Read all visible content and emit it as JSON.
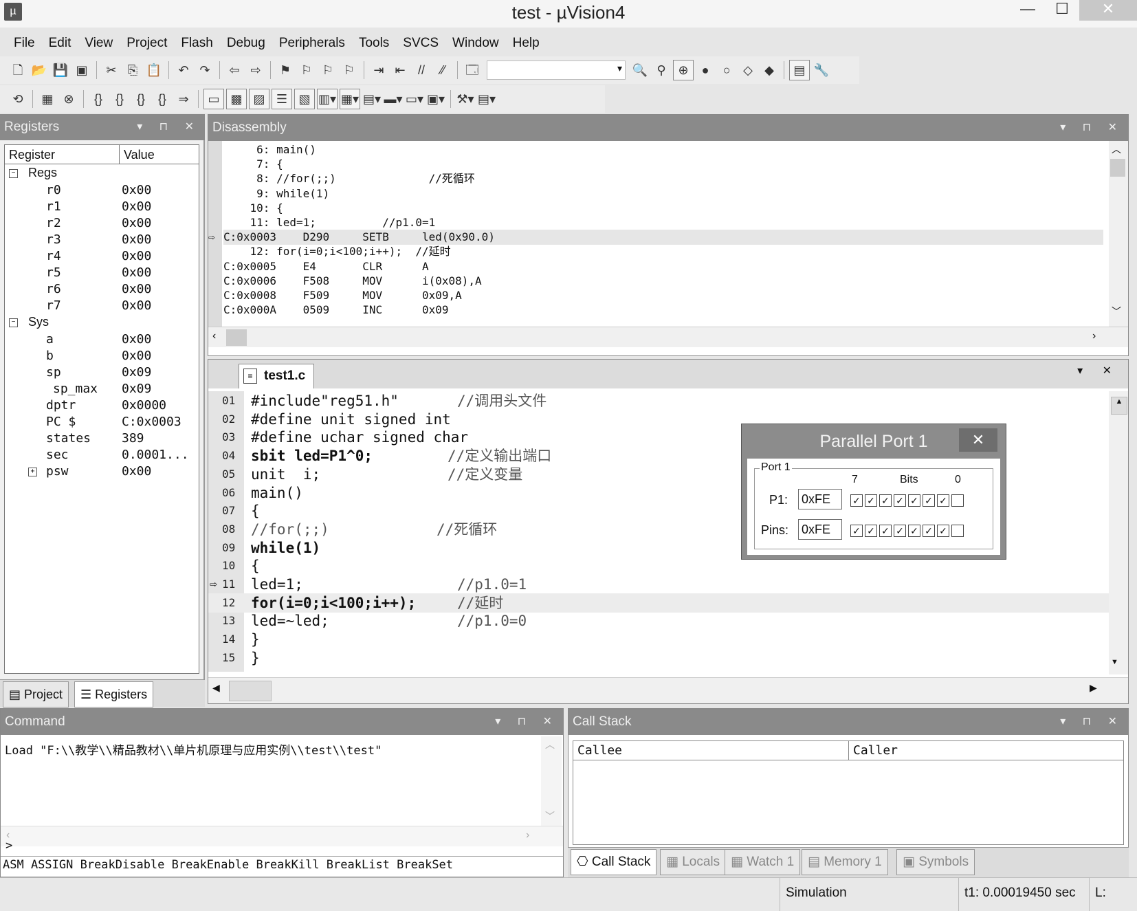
{
  "window": {
    "title": "test  - µVision4",
    "app_icon": "µ",
    "buttons": {
      "minimize": "—",
      "maximize": "☐",
      "close": "✕"
    }
  },
  "menu": [
    "File",
    "Edit",
    "View",
    "Project",
    "Flash",
    "Debug",
    "Peripherals",
    "Tools",
    "SVCS",
    "Window",
    "Help"
  ],
  "registers": {
    "title": "Registers",
    "columns": [
      "Register",
      "Value"
    ],
    "groups": [
      {
        "name": "Regs",
        "expanded": true,
        "items": [
          {
            "name": "r0",
            "value": "0x00"
          },
          {
            "name": "r1",
            "value": "0x00"
          },
          {
            "name": "r2",
            "value": "0x00"
          },
          {
            "name": "r3",
            "value": "0x00"
          },
          {
            "name": "r4",
            "value": "0x00"
          },
          {
            "name": "r5",
            "value": "0x00"
          },
          {
            "name": "r6",
            "value": "0x00"
          },
          {
            "name": "r7",
            "value": "0x00"
          }
        ]
      },
      {
        "name": "Sys",
        "expanded": true,
        "items": [
          {
            "name": "a",
            "value": "0x00"
          },
          {
            "name": "b",
            "value": "0x00"
          },
          {
            "name": "sp",
            "value": "0x09"
          },
          {
            "name": "sp_max",
            "value": "0x09"
          },
          {
            "name": "dptr",
            "value": "0x0000"
          },
          {
            "name": "PC  $",
            "value": "C:0x0003"
          },
          {
            "name": "states",
            "value": "389"
          },
          {
            "name": "sec",
            "value": "0.0001..."
          },
          {
            "name": "psw",
            "value": "0x00"
          }
        ]
      }
    ],
    "tabs": [
      "Project",
      "Registers"
    ]
  },
  "disassembly": {
    "title": "Disassembly",
    "lines": [
      {
        "text": "     6: main()",
        "current": false
      },
      {
        "text": "     7: {",
        "current": false
      },
      {
        "text": "     8: //for(;;)              //死循环",
        "current": false
      },
      {
        "text": "     9: while(1)",
        "current": false
      },
      {
        "text": "    10: {",
        "current": false
      },
      {
        "text": "    11: led=1;          //p1.0=1",
        "current": false
      },
      {
        "text": "C:0x0003    D290     SETB     led(0x90.0)",
        "current": true
      },
      {
        "text": "    12: for(i=0;i<100;i++);  //延时",
        "current": false
      },
      {
        "text": "C:0x0005    E4       CLR      A",
        "current": false
      },
      {
        "text": "C:0x0006    F508     MOV      i(0x08),A",
        "current": false
      },
      {
        "text": "C:0x0008    F509     MOV      0x09,A",
        "current": false
      },
      {
        "text": "C:0x000A    0509     INC      0x09",
        "current": false
      }
    ]
  },
  "editor": {
    "tab": "test1.c",
    "lines": [
      {
        "num": "01",
        "code": "#include\"reg51.h\"",
        "comment": "//调用头文件",
        "bold": false
      },
      {
        "num": "02",
        "code": "#define unit signed int",
        "comment": "",
        "bold": false
      },
      {
        "num": "03",
        "code": "#define uchar signed char",
        "comment": "",
        "bold": false
      },
      {
        "num": "04",
        "code": "sbit led=P1^0;",
        "comment": "//定义输出端口",
        "bold": false
      },
      {
        "num": "05",
        "code": "unit  i;",
        "comment": "//定义变量",
        "bold": false
      },
      {
        "num": "06",
        "code": "main()",
        "comment": "",
        "bold": false
      },
      {
        "num": "07",
        "code": "{",
        "comment": "",
        "bold": false
      },
      {
        "num": "08",
        "code": "//for(;;)",
        "comment": "//死循环",
        "bold": false
      },
      {
        "num": "09",
        "code": "while(1)",
        "comment": "",
        "bold": false
      },
      {
        "num": "10",
        "code": "{",
        "comment": "",
        "bold": false
      },
      {
        "num": "11",
        "code": "led=1;",
        "comment": "//p1.0=1",
        "bold": false
      },
      {
        "num": "12",
        "code": "for(i=0;i<100;i++);",
        "comment": "//延时",
        "bold": false
      },
      {
        "num": "13",
        "code": "led=~led;",
        "comment": "//p1.0=0",
        "bold": false
      },
      {
        "num": "14",
        "code": "}",
        "comment": "",
        "bold": false
      },
      {
        "num": "15",
        "code": "}",
        "comment": "",
        "bold": false
      }
    ]
  },
  "parallel_port": {
    "title": "Parallel Port 1",
    "group": "Port 1",
    "bits_label": "Bits",
    "bit_high": "7",
    "bit_low": "0",
    "p1_label": "P1:",
    "p1_value": "0xFE",
    "pins_label": "Pins:",
    "pins_value": "0xFE",
    "p1_bits": [
      true,
      true,
      true,
      true,
      true,
      true,
      true,
      false
    ],
    "pins_bits": [
      true,
      true,
      true,
      true,
      true,
      true,
      true,
      false
    ]
  },
  "command": {
    "title": "Command",
    "output": "Load \"F:\\\\教学\\\\精品教材\\\\单片机原理与应用实例\\\\test\\\\test\"",
    "prompt": ">",
    "hint": "ASM ASSIGN BreakDisable BreakEnable BreakKill BreakList BreakSet"
  },
  "callstack": {
    "title": "Call Stack",
    "columns": [
      "Callee",
      "Caller"
    ],
    "tabs": [
      "Call Stack",
      "Locals",
      "Watch 1",
      "Memory 1",
      "Symbols"
    ]
  },
  "status": {
    "mode": "Simulation",
    "time": "t1: 0.00019450 sec",
    "extra": "L:"
  }
}
